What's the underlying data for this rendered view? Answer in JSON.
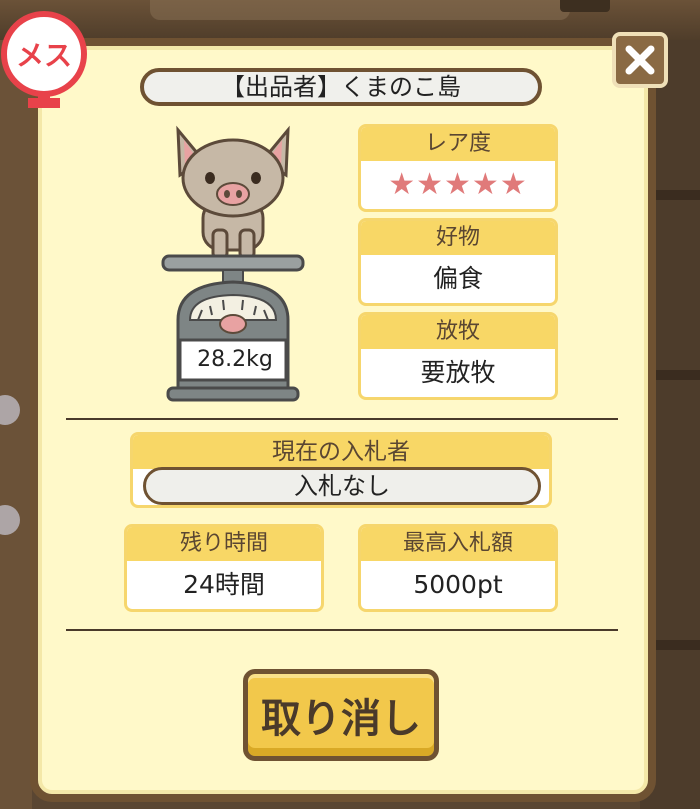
{
  "seller_label": "【出品者】くまのこ島",
  "gender_label": "メス",
  "weight": "28.2kg",
  "rarity": {
    "label": "レア度",
    "stars": "★★★★★",
    "value": 5
  },
  "favorite": {
    "label": "好物",
    "value": "偏食"
  },
  "grazing": {
    "label": "放牧",
    "value": "要放牧"
  },
  "current_bidder": {
    "label": "現在の入札者",
    "value": "入札なし"
  },
  "time_left": {
    "label": "残り時間",
    "value": "24時間"
  },
  "highest_bid": {
    "label": "最高入札額",
    "value": "5000pt"
  },
  "cancel_label": "取り消し",
  "colors": {
    "panel_bg": "#fff9c9",
    "border": "#6f5232",
    "header_yellow": "#f8d766",
    "star_pink": "#e07a7a",
    "badge_red": "#e8424a"
  }
}
